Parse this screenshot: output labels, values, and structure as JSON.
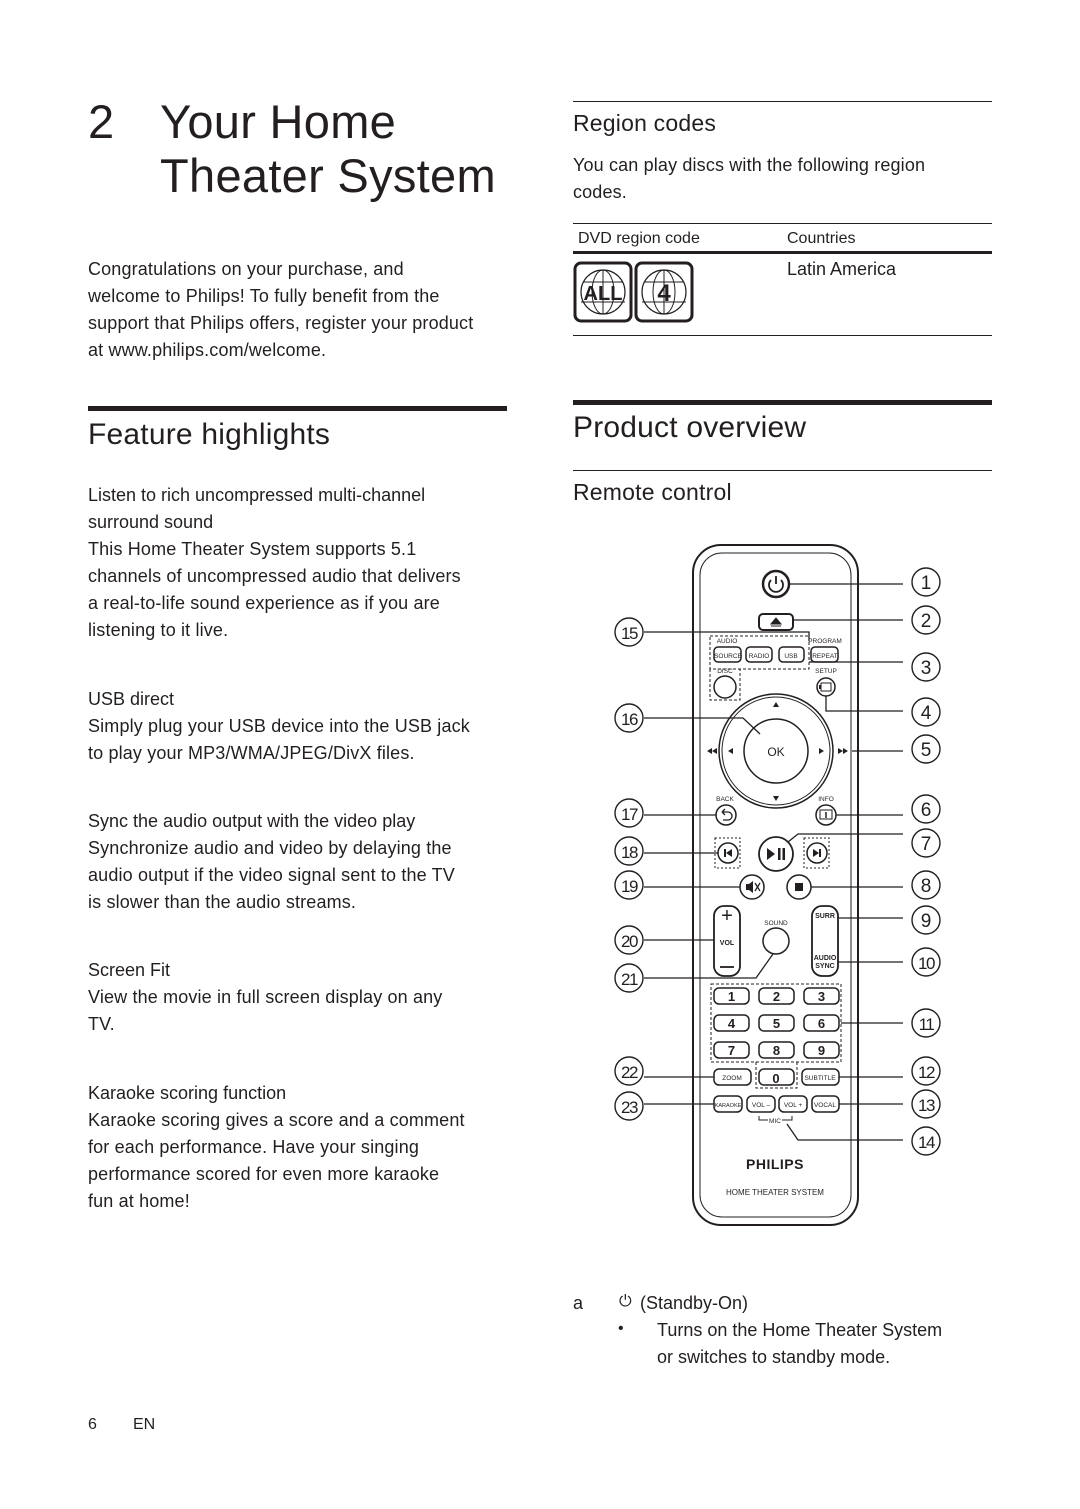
{
  "chapter": {
    "number": "2",
    "title_line1": "Your Home",
    "title_line2": "Theater System"
  },
  "intro": {
    "lines": [
      "Congratulations on your purchase, and",
      "welcome to Philips! To fully benefit from the",
      "support that Philips offers, register your product",
      "at www.philips.com/welcome."
    ]
  },
  "feature_highlights": {
    "heading": "Feature highlights",
    "items": [
      {
        "title_lines": [
          "Listen to rich uncompressed multi-channel",
          "surround sound"
        ],
        "body_lines": [
          "This Home Theater System supports 5.1",
          "channels of uncompressed audio that delivers",
          "a real-to-life sound experience as if you are",
          "listening to it live."
        ]
      },
      {
        "title_lines": [
          "USB direct"
        ],
        "body_lines": [
          "Simply plug your USB device into the USB jack",
          "to play your MP3/WMA/JPEG/DivX files."
        ]
      },
      {
        "title_lines": [
          "Sync the audio output with the video play"
        ],
        "body_lines": [
          "Synchronize audio and video by delaying the",
          "audio output if the video signal sent to the TV",
          "is slower than the audio streams."
        ]
      },
      {
        "title_lines": [
          "Screen Fit"
        ],
        "body_lines": [
          "View the movie in full screen display on any",
          "TV."
        ]
      },
      {
        "title_lines": [
          "Karaoke scoring function"
        ],
        "body_lines": [
          "Karaoke scoring gives a score and a comment",
          "for each performance. Have your singing",
          "performance scored for even more karaoke",
          "fun at home!"
        ]
      }
    ]
  },
  "region_codes": {
    "heading": "Region codes",
    "intro_lines": [
      "You can play discs with the following region",
      "codes."
    ],
    "table": {
      "headers": [
        "DVD region code",
        "Countries"
      ],
      "rows": [
        {
          "codes": [
            "ALL",
            "4"
          ],
          "country": "Latin America"
        }
      ]
    }
  },
  "product_overview": {
    "heading": "Product overview",
    "subheading": "Remote control"
  },
  "remote": {
    "brand": "PHILIPS",
    "model_text": "HOME THEATER SYSTEM",
    "labels": {
      "audio": "AUDIO",
      "source": "SOURCE",
      "radio": "RADIO",
      "usb": "USB",
      "program": "PROGRAM",
      "repeat": "REPEAT",
      "disc": "DISC",
      "setup": "SETUP",
      "ok": "OK",
      "back": "BACK",
      "info": "INFO",
      "vol": "VOL",
      "sound": "SOUND",
      "surr": "SURR",
      "audio_sync_1": "AUDIO",
      "audio_sync_2": "SYNC",
      "zoom": "ZOOM",
      "subtitle": "SUBTITLE",
      "karaoke": "KARAOKE",
      "vol_minus": "VOL –",
      "vol_plus": "VOL +",
      "vocal": "VOCAL",
      "mic": "MIC",
      "digits": [
        "1",
        "2",
        "3",
        "4",
        "5",
        "6",
        "7",
        "8",
        "9",
        "0"
      ]
    },
    "callouts_right": [
      "1",
      "2",
      "3",
      "4",
      "5",
      "6",
      "7",
      "8",
      "9",
      "10",
      "11",
      "12",
      "13",
      "14"
    ],
    "callouts_left": [
      "15",
      "16",
      "17",
      "18",
      "19",
      "20",
      "21",
      "22",
      "23"
    ]
  },
  "key_list": {
    "items": [
      {
        "letter": "a",
        "name": "(Standby-On)",
        "bullets": [
          "Turns on the Home Theater System",
          "or switches to standby mode."
        ]
      }
    ]
  },
  "footer": {
    "page": "6",
    "lang": "EN"
  }
}
